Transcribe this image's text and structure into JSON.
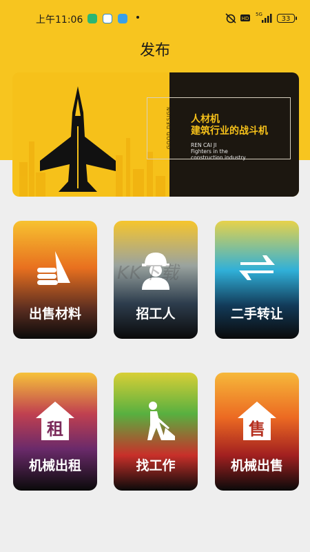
{
  "status_bar": {
    "time": "上午11:06",
    "battery": "33",
    "network": "5G"
  },
  "header": {
    "title": "发布"
  },
  "banner": {
    "vertical_text": "GOOD DESIGN",
    "title_line1": "人材机",
    "title_line2": "建筑行业的战斗机",
    "pinyin": "REN CAI JI",
    "sub_line1": "Fighters in the",
    "sub_line2": "construction industry"
  },
  "tiles": [
    {
      "label": "出售材料",
      "icon": "hand-icon"
    },
    {
      "label": "招工人",
      "icon": "worker-icon"
    },
    {
      "label": "二手转让",
      "icon": "transfer-arrows-icon"
    },
    {
      "label": "机械出租",
      "icon": "rent-house-icon",
      "icon_text": "租"
    },
    {
      "label": "找工作",
      "icon": "digging-worker-icon"
    },
    {
      "label": "机械出售",
      "icon": "sell-house-icon",
      "icon_text": "售"
    }
  ],
  "watermark": "KK下载",
  "colors": {
    "brand_yellow": "#f7c51f",
    "banner_dark": "#1c1710"
  }
}
